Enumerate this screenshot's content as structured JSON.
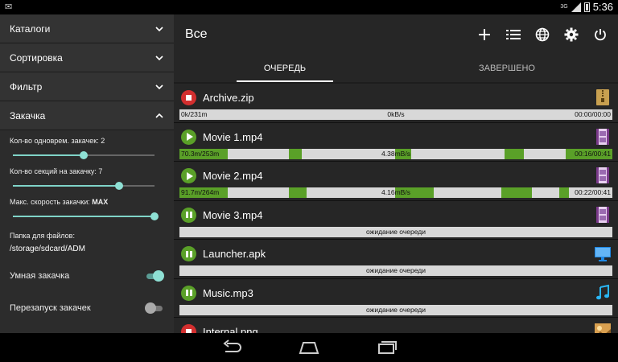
{
  "statusbar": {
    "network": "3G",
    "time": "5:36"
  },
  "sidebar": {
    "sections": [
      {
        "label": "Каталоги"
      },
      {
        "label": "Сортировка"
      },
      {
        "label": "Фильтр"
      },
      {
        "label": "Закачка"
      }
    ],
    "settings": [
      {
        "label": "Кол-во одноврем. закачек: 2",
        "level": 0.5
      },
      {
        "label": "Кол-во секций на закачку: 7",
        "level": 0.75
      },
      {
        "label_prefix": "Макс. скорость закачки:",
        "label_value": "MAX",
        "level": 1.0
      }
    ],
    "folder": {
      "label": "Папка для файлов:",
      "path": "/storage/sdcard/ADM"
    },
    "toggles": [
      {
        "label": "Умная закачка",
        "on": true
      },
      {
        "label": "Перезапуск закачек",
        "on": false
      }
    ]
  },
  "appbar": {
    "title": "Все",
    "actions": [
      "add-icon",
      "list-icon",
      "globe-icon",
      "gear-icon",
      "power-icon"
    ]
  },
  "tabs": [
    {
      "label": "ОЧЕРЕДЬ",
      "active": true
    },
    {
      "label": "ЗАВЕРШЕНО",
      "active": false
    }
  ],
  "downloads": [
    {
      "name": "Archive.zip",
      "state": "stopped",
      "icon": "archive-icon",
      "size": "0k/231m",
      "speed": "0kB/s",
      "time": "00:00/00:00",
      "progress": 0.0
    },
    {
      "name": "Movie 1.mp4",
      "state": "playing",
      "icon": "video-icon",
      "size": "70.3m/253m",
      "speed": "4.38mB/s",
      "time": "00:16/00:41",
      "progress": 0.28
    },
    {
      "name": "Movie 2.mp4",
      "state": "playing",
      "icon": "video-icon",
      "size": "91.7m/264m",
      "speed": "4.16mB/s",
      "time": "00:22/00:41",
      "progress": 0.35
    },
    {
      "name": "Movie 3.mp4",
      "state": "paused",
      "icon": "video-icon",
      "status": "ожидание очереди"
    },
    {
      "name": "Launcher.apk",
      "state": "paused",
      "icon": "monitor-icon",
      "status": "ожидание очереди"
    },
    {
      "name": "Music.mp3",
      "state": "paused",
      "icon": "music-icon",
      "status": "ожидание очереди"
    },
    {
      "name": "Internal.png",
      "state": "stopped",
      "icon": "image-icon"
    }
  ],
  "colors": {
    "accent": "#7fd4c8",
    "progress": "#5aa028",
    "stop": "#d32f2f"
  }
}
